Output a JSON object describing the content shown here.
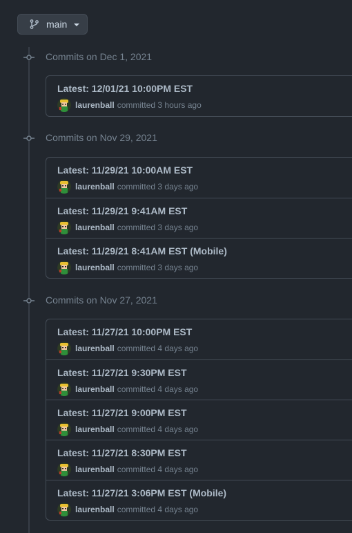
{
  "branch": {
    "name": "main",
    "icon": "git-branch-icon"
  },
  "groups": [
    {
      "title": "Commits on Dec 1, 2021",
      "commits": [
        {
          "title": "Latest: 12/01/21 10:00PM EST",
          "author": "laurenball",
          "action": "committed",
          "time": "3 hours ago"
        }
      ]
    },
    {
      "title": "Commits on Nov 29, 2021",
      "commits": [
        {
          "title": "Latest: 11/29/21 10:00AM EST",
          "author": "laurenball",
          "action": "committed",
          "time": "3 days ago"
        },
        {
          "title": "Latest: 11/29/21 9:41AM EST",
          "author": "laurenball",
          "action": "committed",
          "time": "3 days ago"
        },
        {
          "title": "Latest: 11/29/21 8:41AM EST (Mobile)",
          "author": "laurenball",
          "action": "committed",
          "time": "3 days ago"
        }
      ]
    },
    {
      "title": "Commits on Nov 27, 2021",
      "commits": [
        {
          "title": "Latest: 11/27/21 10:00PM EST",
          "author": "laurenball",
          "action": "committed",
          "time": "4 days ago"
        },
        {
          "title": "Latest: 11/27/21 9:30PM EST",
          "author": "laurenball",
          "action": "committed",
          "time": "4 days ago"
        },
        {
          "title": "Latest: 11/27/21 9:00PM EST",
          "author": "laurenball",
          "action": "committed",
          "time": "4 days ago"
        },
        {
          "title": "Latest: 11/27/21 8:30PM EST",
          "author": "laurenball",
          "action": "committed",
          "time": "4 days ago"
        },
        {
          "title": "Latest: 11/27/21 3:06PM EST (Mobile)",
          "author": "laurenball",
          "action": "committed",
          "time": "4 days ago"
        }
      ]
    }
  ],
  "colors": {
    "background": "#22272e",
    "border": "#444c56",
    "muted_text": "#768390",
    "text": "#adbac7"
  }
}
